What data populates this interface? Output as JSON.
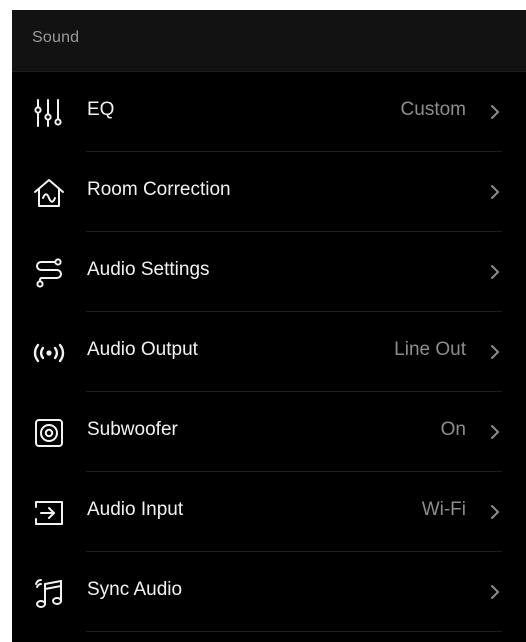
{
  "section": {
    "title": "Sound"
  },
  "rows": [
    {
      "label": "EQ",
      "value": "Custom",
      "icon": "equalizer-sliders-icon"
    },
    {
      "label": "Room Correction",
      "value": "",
      "icon": "room-correction-house-icon"
    },
    {
      "label": "Audio Settings",
      "value": "",
      "icon": "audio-settings-path-icon"
    },
    {
      "label": "Audio Output",
      "value": "Line Out",
      "icon": "broadcast-output-icon"
    },
    {
      "label": "Subwoofer",
      "value": "On",
      "icon": "subwoofer-speaker-icon"
    },
    {
      "label": "Audio Input",
      "value": "Wi-Fi",
      "icon": "input-arrow-icon"
    },
    {
      "label": "Sync Audio",
      "value": "",
      "icon": "sync-audio-note-icon"
    }
  ],
  "colors": {
    "background": "#000000",
    "header": "#121212",
    "label": "#f2f2f2",
    "value": "#8d8d8d"
  }
}
